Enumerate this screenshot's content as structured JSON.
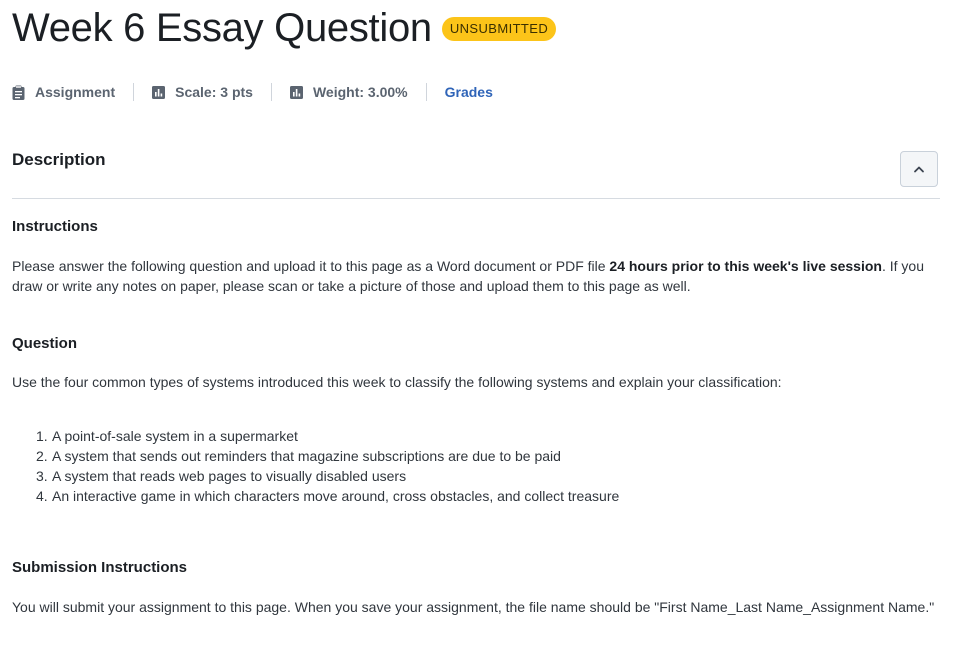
{
  "header": {
    "title": "Week 6 Essay Question",
    "status_badge": "UNSUBMITTED"
  },
  "meta": {
    "type_label": "Assignment",
    "scale_label": "Scale: 3 pts",
    "weight_label": "Weight: 3.00%",
    "grades_link": "Grades"
  },
  "description": {
    "heading": "Description",
    "collapse_icon": "chevron-up-icon"
  },
  "instructions": {
    "heading": "Instructions",
    "text_before": "Please answer the following question and upload it to this page as a Word document or PDF file ",
    "text_bold": "24 hours prior to this week's live session",
    "text_after": ". If you draw or write any notes on paper, please scan or take a picture of those and upload them to this page as well."
  },
  "question": {
    "heading": "Question",
    "intro": "Use the four common types of systems introduced this week to classify the following systems and explain your classification:",
    "items": [
      {
        "num": "1.",
        "text": "A point-of-sale system in a supermarket"
      },
      {
        "num": "2.",
        "text": "A system that sends out reminders that magazine subscriptions are due to be paid"
      },
      {
        "num": "3.",
        "text": "A system that reads web pages to visually disabled users"
      },
      {
        "num": "4.",
        "text": "An interactive game in which characters move around, cross obstacles, and collect treasure"
      }
    ]
  },
  "submission": {
    "heading": "Submission Instructions",
    "text": "You will submit your assignment to this page. When you save your assignment, the file name should be \"First Name_Last Name_Assignment Name.\""
  },
  "colors": {
    "badge_bg": "#fcc419",
    "link": "#2f64b8",
    "meta_text": "#5b6470"
  }
}
